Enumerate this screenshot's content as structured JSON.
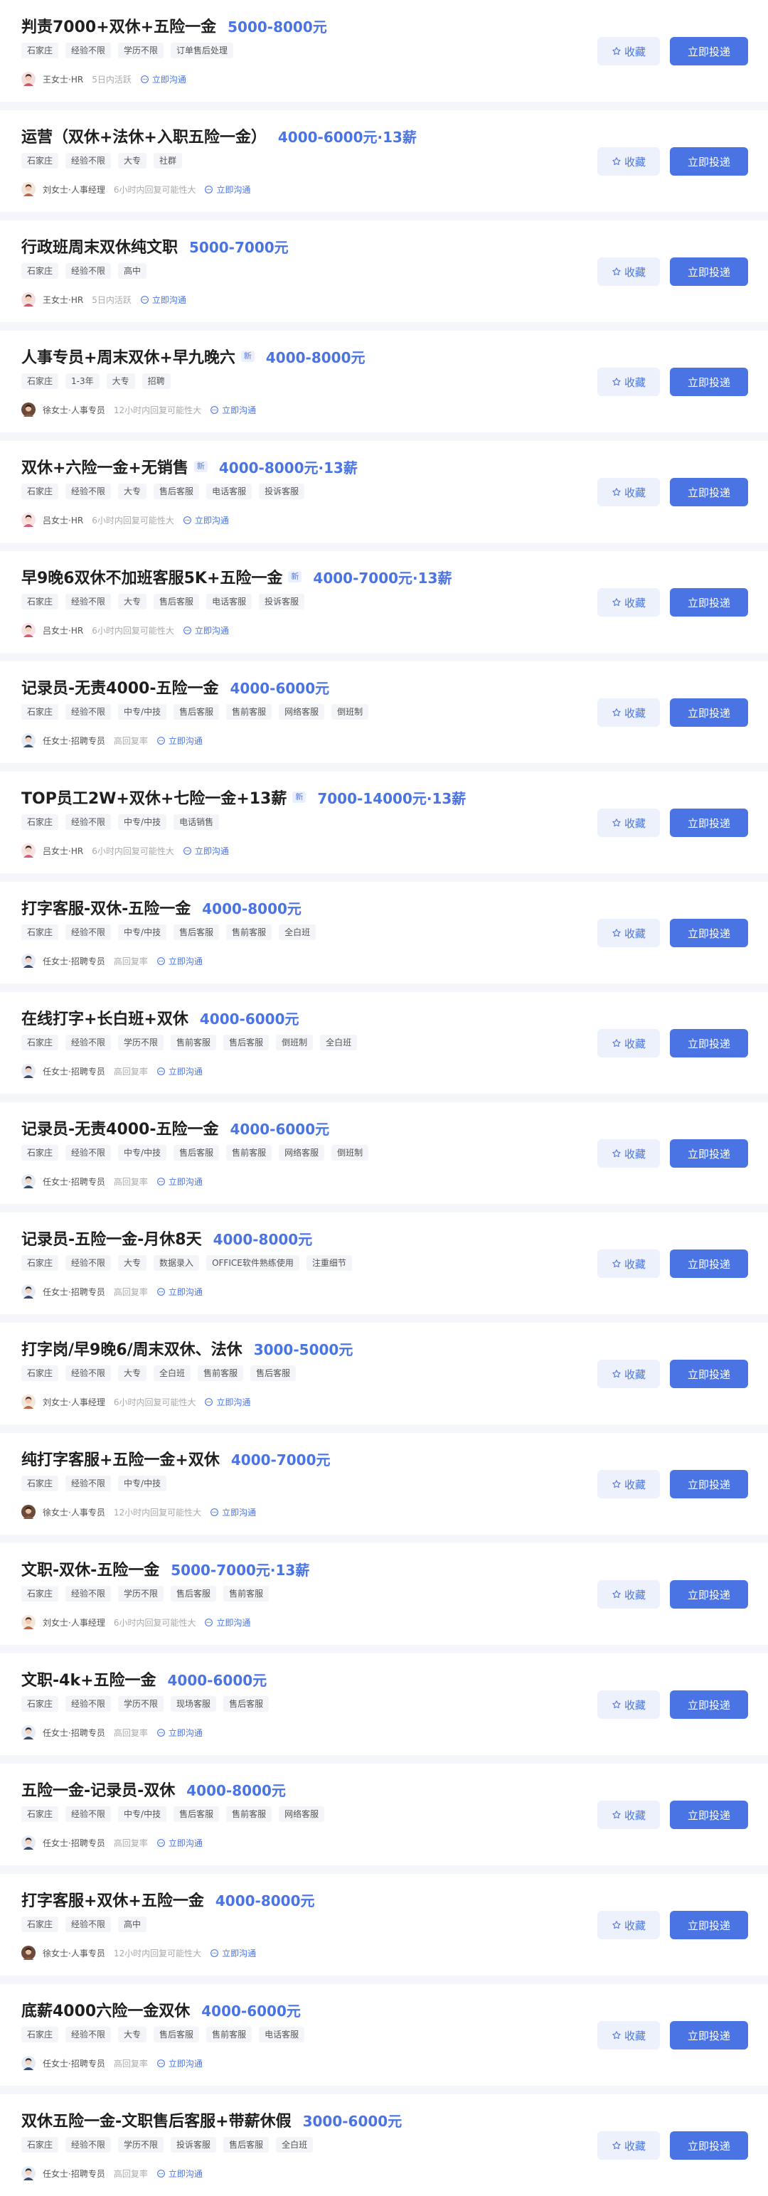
{
  "ui": {
    "favorite_label": "收藏",
    "apply_label": "立即投递",
    "chat_label": "立即沟通",
    "new_badge": "新"
  },
  "jobs": [
    {
      "title": "判责7000+双休+五险一金",
      "salary": "5000-8000元",
      "is_new": false,
      "tags": [
        "石家庄",
        "经验不限",
        "学历不限",
        "订单售后处理"
      ],
      "recruiter": "王女士·HR",
      "status": "5日内活跃",
      "avatar": "a1"
    },
    {
      "title": "运营（双休+法休+入职五险一金）",
      "salary": "4000-6000元·13薪",
      "is_new": false,
      "tags": [
        "石家庄",
        "经验不限",
        "大专",
        "社群"
      ],
      "recruiter": "刘女士·人事经理",
      "status": "6小时内回复可能性大",
      "avatar": "a2"
    },
    {
      "title": "行政班周末双休纯文职",
      "salary": "5000-7000元",
      "is_new": false,
      "tags": [
        "石家庄",
        "经验不限",
        "高中"
      ],
      "recruiter": "王女士·HR",
      "status": "5日内活跃",
      "avatar": "a1"
    },
    {
      "title": "人事专员+周末双休+早九晚六",
      "salary": "4000-8000元",
      "is_new": true,
      "tags": [
        "石家庄",
        "1-3年",
        "大专",
        "招聘"
      ],
      "recruiter": "徐女士·人事专员",
      "status": "12小时内回复可能性大",
      "avatar": "a3"
    },
    {
      "title": "双休+六险一金+无销售",
      "salary": "4000-8000元·13薪",
      "is_new": true,
      "tags": [
        "石家庄",
        "经验不限",
        "大专",
        "售后客服",
        "电话客服",
        "投诉客服"
      ],
      "recruiter": "吕女士·HR",
      "status": "6小时内回复可能性大",
      "avatar": "a4"
    },
    {
      "title": "早9晚6双休不加班客服5K+五险一金",
      "salary": "4000-7000元·13薪",
      "is_new": true,
      "tags": [
        "石家庄",
        "经验不限",
        "大专",
        "售后客服",
        "电话客服",
        "投诉客服"
      ],
      "recruiter": "吕女士·HR",
      "status": "6小时内回复可能性大",
      "avatar": "a4"
    },
    {
      "title": "记录员-无责4000-五险一金",
      "salary": "4000-6000元",
      "is_new": false,
      "tags": [
        "石家庄",
        "经验不限",
        "中专/中技",
        "售后客服",
        "售前客服",
        "网络客服",
        "倒班制"
      ],
      "recruiter": "任女士·招聘专员",
      "status": "高回复率",
      "avatar": "a5"
    },
    {
      "title": "TOP员工2W+双休+七险一金+13薪",
      "salary": "7000-14000元·13薪",
      "is_new": true,
      "tags": [
        "石家庄",
        "经验不限",
        "中专/中技",
        "电话销售"
      ],
      "recruiter": "吕女士·HR",
      "status": "6小时内回复可能性大",
      "avatar": "a4"
    },
    {
      "title": "打字客服-双休-五险一金",
      "salary": "4000-8000元",
      "is_new": false,
      "tags": [
        "石家庄",
        "经验不限",
        "中专/中技",
        "售后客服",
        "售前客服",
        "全白班"
      ],
      "recruiter": "任女士·招聘专员",
      "status": "高回复率",
      "avatar": "a5"
    },
    {
      "title": "在线打字+长白班+双休",
      "salary": "4000-6000元",
      "is_new": false,
      "tags": [
        "石家庄",
        "经验不限",
        "学历不限",
        "售前客服",
        "售后客服",
        "倒班制",
        "全白班"
      ],
      "recruiter": "任女士·招聘专员",
      "status": "高回复率",
      "avatar": "a5"
    },
    {
      "title": "记录员-无责4000-五险一金",
      "salary": "4000-6000元",
      "is_new": false,
      "tags": [
        "石家庄",
        "经验不限",
        "中专/中技",
        "售后客服",
        "售前客服",
        "网络客服",
        "倒班制"
      ],
      "recruiter": "任女士·招聘专员",
      "status": "高回复率",
      "avatar": "a5"
    },
    {
      "title": "记录员-五险一金-月休8天",
      "salary": "4000-8000元",
      "is_new": false,
      "tags": [
        "石家庄",
        "经验不限",
        "大专",
        "数据录入",
        "OFFICE软件熟练使用",
        "注重细节"
      ],
      "recruiter": "任女士·招聘专员",
      "status": "高回复率",
      "avatar": "a5"
    },
    {
      "title": "打字岗/早9晚6/周末双休、法休",
      "salary": "3000-5000元",
      "is_new": false,
      "tags": [
        "石家庄",
        "经验不限",
        "大专",
        "全白班",
        "售前客服",
        "售后客服"
      ],
      "recruiter": "刘女士·人事经理",
      "status": "6小时内回复可能性大",
      "avatar": "a2"
    },
    {
      "title": "纯打字客服+五险一金+双休",
      "salary": "4000-7000元",
      "is_new": false,
      "tags": [
        "石家庄",
        "经验不限",
        "中专/中技"
      ],
      "recruiter": "徐女士·人事专员",
      "status": "12小时内回复可能性大",
      "avatar": "a3"
    },
    {
      "title": "文职-双休-五险一金",
      "salary": "5000-7000元·13薪",
      "is_new": false,
      "tags": [
        "石家庄",
        "经验不限",
        "学历不限",
        "售后客服",
        "售前客服"
      ],
      "recruiter": "刘女士·人事经理",
      "status": "6小时内回复可能性大",
      "avatar": "a2"
    },
    {
      "title": "文职-4k+五险一金",
      "salary": "4000-6000元",
      "is_new": false,
      "tags": [
        "石家庄",
        "经验不限",
        "学历不限",
        "现场客服",
        "售后客服"
      ],
      "recruiter": "任女士·招聘专员",
      "status": "高回复率",
      "avatar": "a5"
    },
    {
      "title": "五险一金-记录员-双休",
      "salary": "4000-8000元",
      "is_new": false,
      "tags": [
        "石家庄",
        "经验不限",
        "中专/中技",
        "售后客服",
        "售前客服",
        "网络客服"
      ],
      "recruiter": "任女士·招聘专员",
      "status": "高回复率",
      "avatar": "a5"
    },
    {
      "title": "打字客服+双休+五险一金",
      "salary": "4000-8000元",
      "is_new": false,
      "tags": [
        "石家庄",
        "经验不限",
        "高中"
      ],
      "recruiter": "徐女士·人事专员",
      "status": "12小时内回复可能性大",
      "avatar": "a3"
    },
    {
      "title": "底薪4000六险一金双休",
      "salary": "4000-6000元",
      "is_new": false,
      "tags": [
        "石家庄",
        "经验不限",
        "大专",
        "售后客服",
        "售前客服",
        "电话客服"
      ],
      "recruiter": "任女士·招聘专员",
      "status": "高回复率",
      "avatar": "a5"
    },
    {
      "title": "双休五险一金-文职售后客服+带薪休假",
      "salary": "3000-6000元",
      "is_new": false,
      "tags": [
        "石家庄",
        "经验不限",
        "学历不限",
        "投诉客服",
        "售后客服",
        "全白班"
      ],
      "recruiter": "任女士·招聘专员",
      "status": "高回复率",
      "avatar": "a5"
    }
  ],
  "colors": {
    "accent": "#4a74e4",
    "background": "#f4f6fa",
    "card": "#ffffff",
    "tag_bg": "#f3f5f9",
    "fav_bg": "#edf1fb"
  },
  "icons": {
    "favorite": "star-outline-icon",
    "chat": "chat-bubble-icon"
  }
}
